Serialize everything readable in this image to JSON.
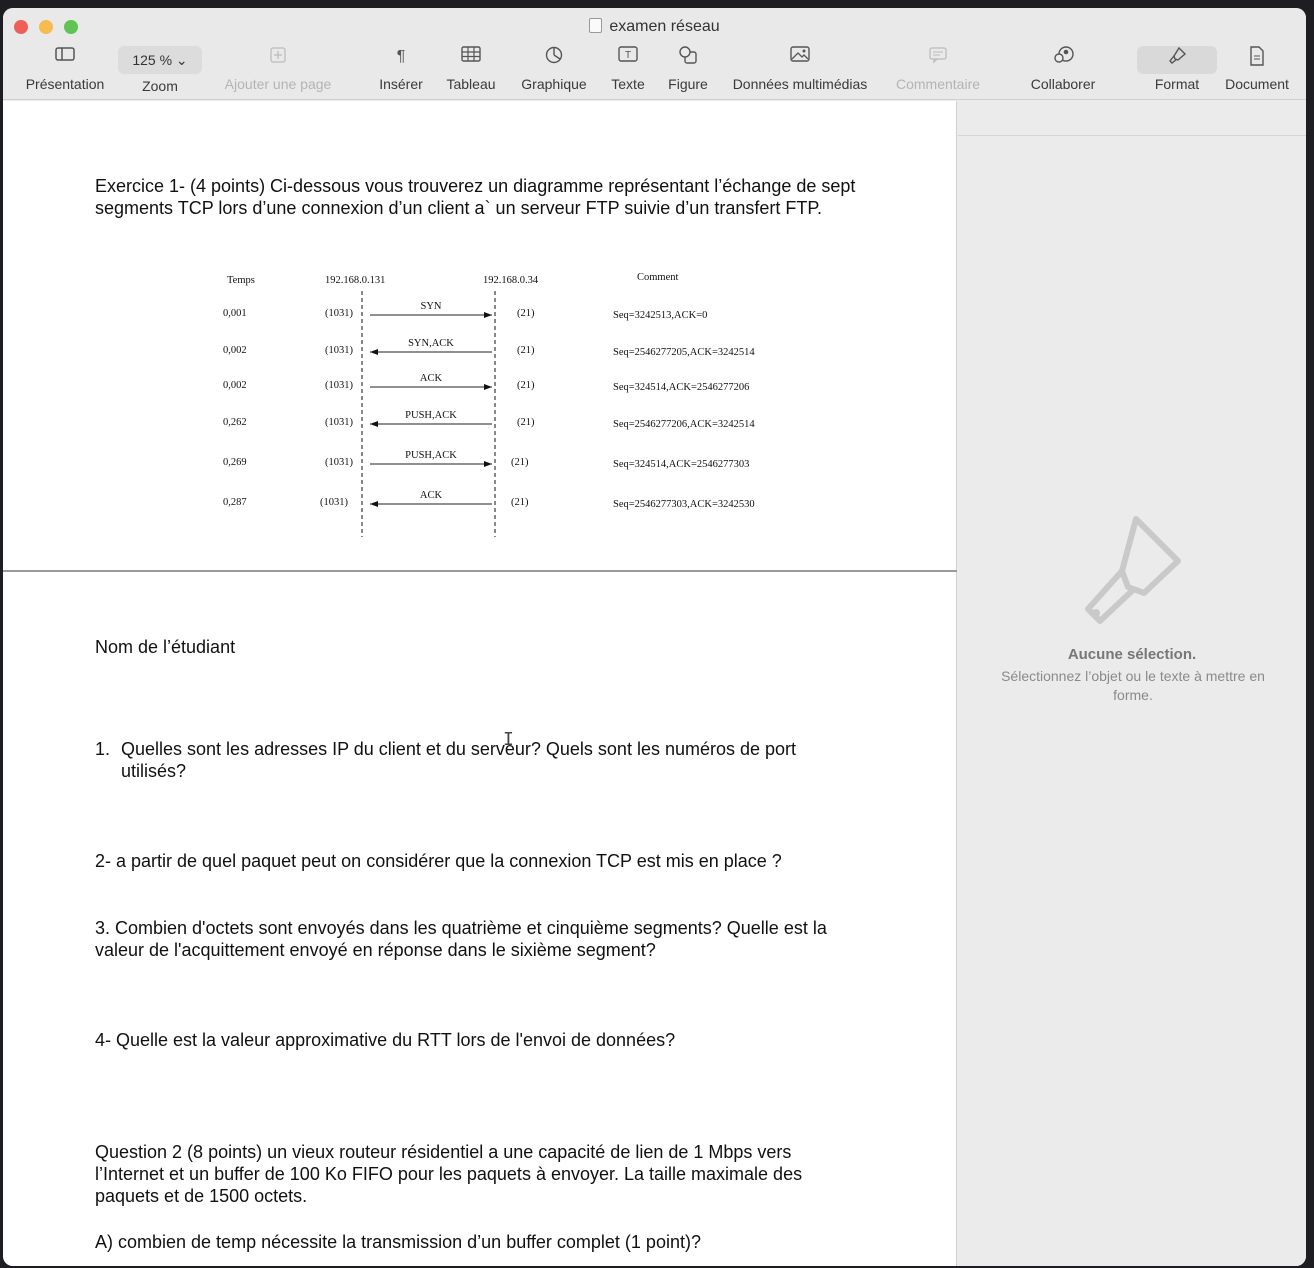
{
  "window": {
    "title": "examen réseau"
  },
  "toolbar": {
    "presentation": "Présentation",
    "zoom_value": "125 %",
    "zoom_label": "Zoom",
    "add_page": "Ajouter une page",
    "insert": "Insérer",
    "table": "Tableau",
    "chart": "Graphique",
    "text": "Texte",
    "shape": "Figure",
    "media": "Données multimédias",
    "comment": "Commentaire",
    "collaborate": "Collaborer",
    "format": "Format",
    "document": "Document"
  },
  "document": {
    "exercise1": "Exercice 1- (4 points) Ci-dessous vous trouverez un diagramme représentant l’échange de sept segments TCP lors d’une connexion d’un client a` un serveur FTP suivie d’un transfert FTP.",
    "student_name": "Nom de l’étudiant",
    "q1_num": "1.",
    "q1": "Quelles sont les adresses IP du client et du serveur? Quels sont les numéros de port utilisés?",
    "q2": "2- a partir de quel paquet peut on considérer que la connexion TCP est mis en place ?",
    "q3": "3. Combien d'octets sont envoyés dans les quatrième et cinquième segments? Quelle est la valeur de l'acquittement envoyé en réponse dans le sixième segment?",
    "q4": "4- Quelle est la valeur approximative du RTT lors de l'envoi de données?",
    "question2": "Question 2 (8 points) un vieux routeur résidentiel a une capacité de lien de 1 Mbps vers l’Internet et un buffer de 100 Ko FIFO pour les paquets à envoyer. La taille maximale des paquets  et de 1500 octets.",
    "qA": "A)  combien de temp nécessite la transmission d’un buffer complet  (1 point)?"
  },
  "diagram": {
    "header_time": "Temps",
    "header_client": "192.168.0.131",
    "header_server": "192.168.0.34",
    "header_comment": "Comment",
    "rows": [
      {
        "time": "0,001",
        "cport": "(1031)",
        "label": "SYN",
        "sport": "(21)",
        "comment": "Seq=3242513,ACK=0",
        "dir": "right"
      },
      {
        "time": "0,002",
        "cport": "(1031)",
        "label": "SYN,ACK",
        "sport": "(21)",
        "comment": "Seq=2546277205,ACK=3242514",
        "dir": "left"
      },
      {
        "time": "0,002",
        "cport": "(1031)",
        "label": "ACK",
        "sport": "(21)",
        "comment": "Seq=324514,ACK=2546277206",
        "dir": "right"
      },
      {
        "time": "0,262",
        "cport": "(1031)",
        "label": "PUSH,ACK",
        "sport": "(21)",
        "comment": "Seq=2546277206,ACK=3242514",
        "dir": "left"
      },
      {
        "time": "0,269",
        "cport": "(1031)",
        "label": "PUSH,ACK",
        "sport": "(21)",
        "comment": "Seq=324514,ACK=2546277303",
        "dir": "right"
      },
      {
        "time": "0,287",
        "cport": "(1031)",
        "label": "ACK",
        "sport": "(21)",
        "comment": "Seq=2546277303,ACK=3242530",
        "dir": "left"
      }
    ]
  },
  "sidebar": {
    "no_selection": "Aucune sélection.",
    "hint": "Sélectionnez l’objet ou le texte à mettre en forme."
  }
}
